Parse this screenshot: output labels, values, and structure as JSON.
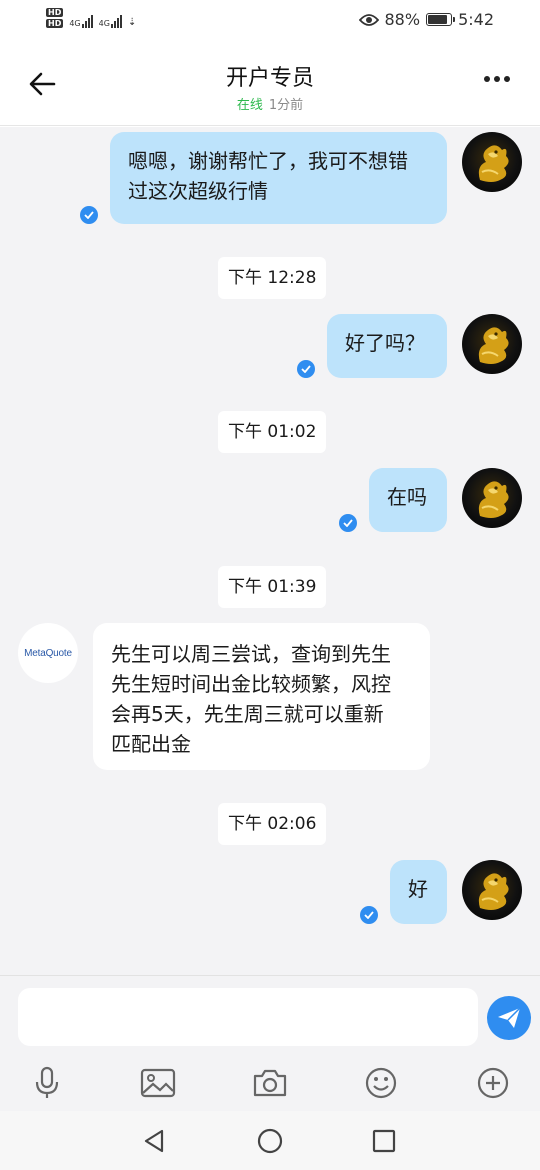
{
  "status_bar": {
    "network_a": "4G",
    "network_b": "4G",
    "battery_percent_text": "88%",
    "battery_level": 0.88,
    "time": "5:42",
    "icons": [
      "hd-icon",
      "signal-icon",
      "eye-icon",
      "battery-icon"
    ]
  },
  "header": {
    "title": "开户专员",
    "online_label": "在线",
    "last_seen": "1分前",
    "back_icon": "arrow-left-icon",
    "more_icon": "more-dots-icon"
  },
  "messages": [
    {
      "type": "outgoing",
      "lines": [
        "嗯嗯，谢谢帮忙了，我可不想错",
        "过这次超级行情"
      ],
      "read": true
    },
    {
      "type": "time",
      "text": "下午 12:28"
    },
    {
      "type": "outgoing",
      "lines": [
        "好了吗？"
      ],
      "read": true
    },
    {
      "type": "time",
      "text": "下午 01:02"
    },
    {
      "type": "outgoing",
      "lines": [
        "在吗"
      ],
      "read": true
    },
    {
      "type": "time",
      "text": "下午 01:39"
    },
    {
      "type": "incoming",
      "sender_logo": "MetaQuote",
      "lines": [
        "先生可以周三尝试，查询到先生",
        "先生短时间出金比较频繁，风控",
        "会再5天，先生周三就可以重新",
        "匹配出金"
      ]
    },
    {
      "type": "time",
      "text": "下午 02:06"
    },
    {
      "type": "outgoing",
      "lines": [
        "好"
      ],
      "read": true
    }
  ],
  "composer": {
    "placeholder": "",
    "send_icon": "send-icon",
    "tools": [
      "microphone-icon",
      "image-icon",
      "camera-icon",
      "emoji-icon",
      "plus-circle-icon"
    ]
  },
  "nav_bar": [
    "back-triangle-icon",
    "home-circle-icon",
    "recents-square-icon"
  ],
  "colors": {
    "outgoing_bubble": "#bde3fb",
    "incoming_bubble": "#ffffff",
    "chat_background": "#f3f3f5",
    "accent_blue": "#2f8df0",
    "online_green": "#2db84d"
  }
}
